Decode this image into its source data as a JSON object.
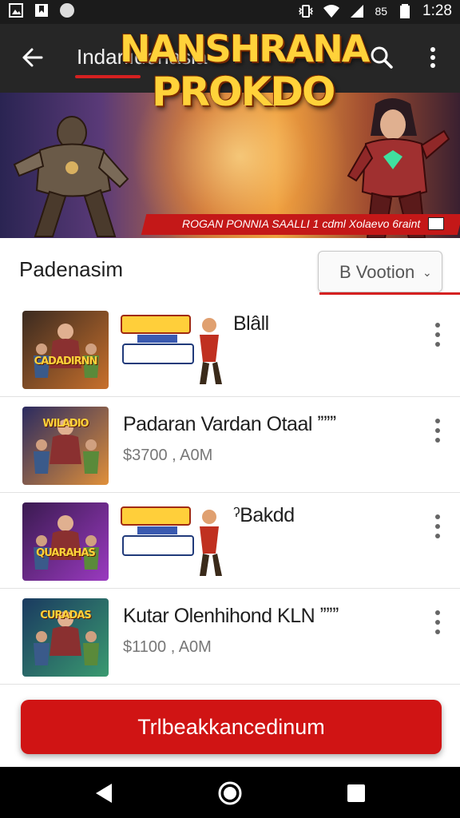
{
  "status_bar": {
    "time": "1:28",
    "battery_text": "85",
    "left_icons": [
      "photo-icon",
      "bookmark-icon",
      "circle-icon"
    ],
    "right_icons": [
      "vibrate-icon",
      "wifi-icon",
      "signal-icon",
      "battery-icon"
    ]
  },
  "app_bar": {
    "title": "Indarlıdonasia",
    "accent_color": "#d52020"
  },
  "banner": {
    "title_line1": "NANSHRANA",
    "title_line2": "PROKDO",
    "strip_text": "ROGAN PONNIA  SAALLI 1 cdml Xolaevo 6raint"
  },
  "section": {
    "title": "Padenasim",
    "sort_label": "B Vootion"
  },
  "items": [
    {
      "thumb_text": "CADADIRNN",
      "thumb_colors": [
        "#3a2a20",
        "#c8702c"
      ],
      "title": "Blâll",
      "price": "",
      "has_logo": true
    },
    {
      "thumb_text": "WILADIO",
      "thumb_colors": [
        "#2a2a60",
        "#e0903a"
      ],
      "title": "Padaran Vardan Otaal ˮˮˮ",
      "price": "$3700 , A0M",
      "has_logo": false
    },
    {
      "thumb_text": "QUARAHAS",
      "thumb_colors": [
        "#3a1a50",
        "#9a3ac0"
      ],
      "title": "ˀBakdd",
      "price": "",
      "has_logo": true
    },
    {
      "thumb_text": "CURADAS",
      "thumb_colors": [
        "#1a3a60",
        "#3a9a70"
      ],
      "title": "Kutar Olenhihond KLN ˮˮˮ",
      "price": "$1100 , A0M",
      "has_logo": false
    }
  ],
  "cta": {
    "label": "Trlbeakkancedinum",
    "color": "#d01414"
  },
  "nav": {
    "icons": [
      "back-triangle-icon",
      "home-circle-icon",
      "recent-square-icon"
    ]
  }
}
